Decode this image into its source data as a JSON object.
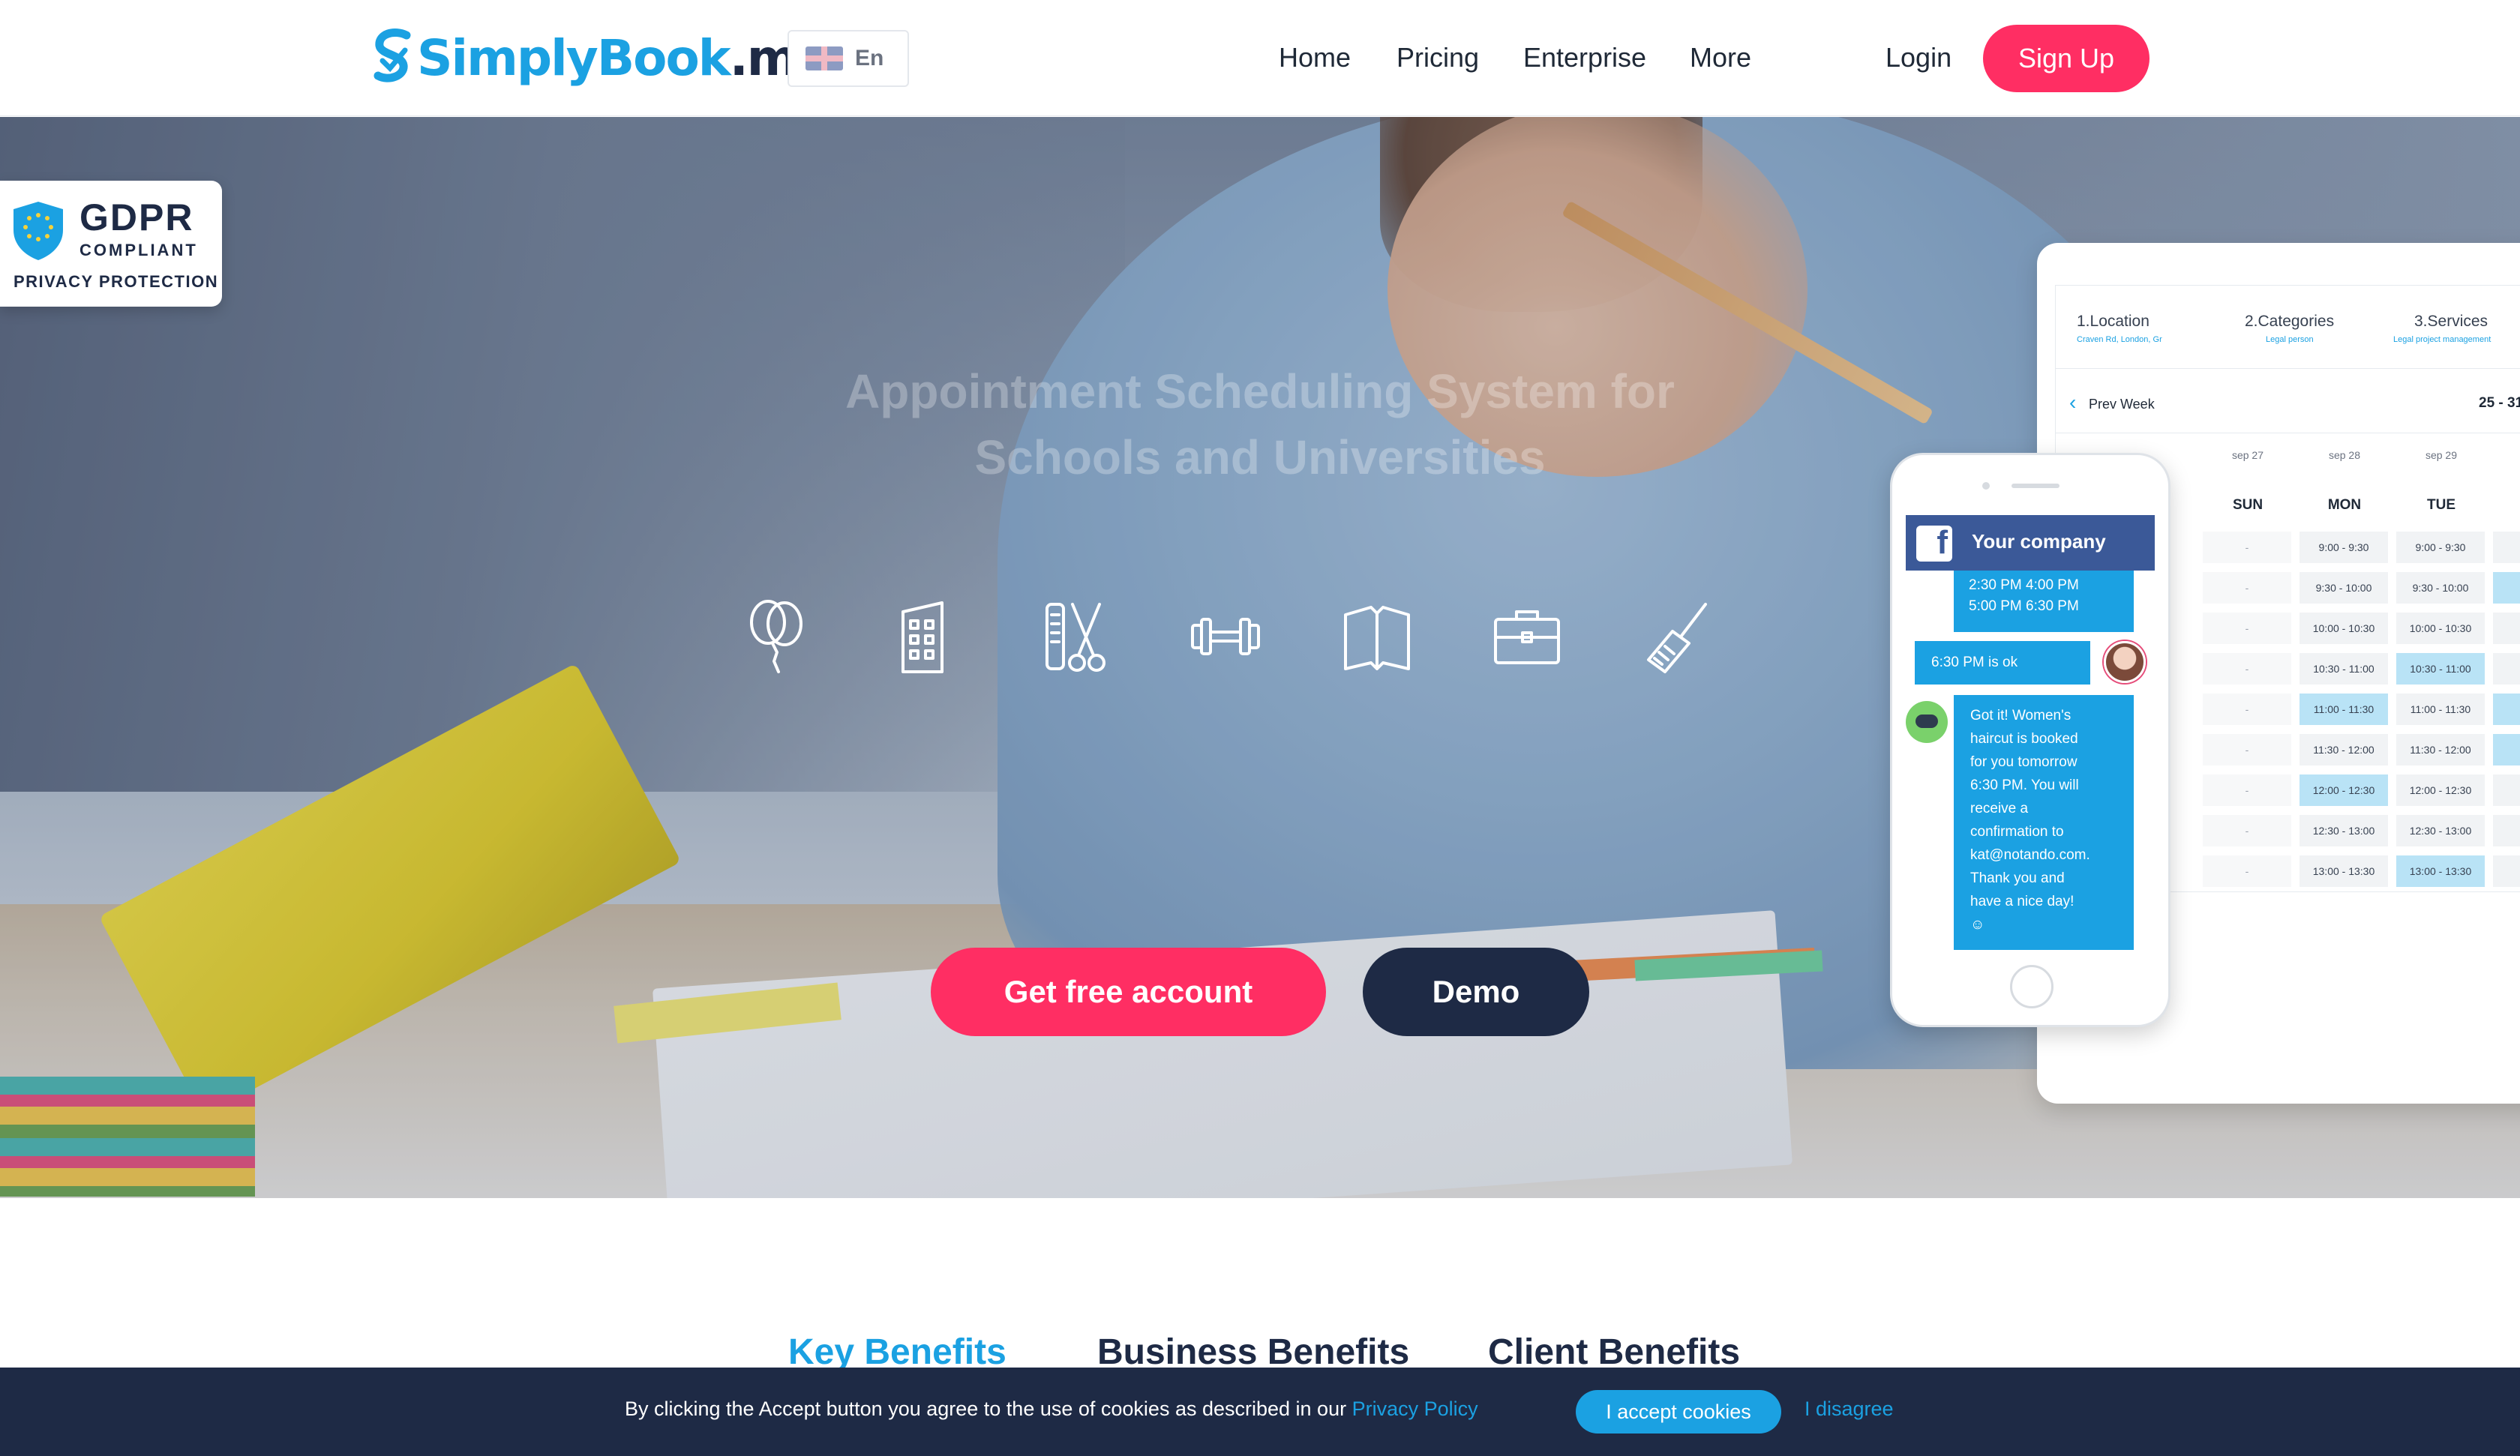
{
  "header": {
    "logo_main": "SimplyBook",
    "logo_suffix": ".me",
    "language": "En",
    "nav": [
      "Home",
      "Pricing",
      "Enterprise",
      "More"
    ],
    "login": "Login",
    "signup": "Sign Up"
  },
  "gdpr": {
    "title": "GDPR",
    "subtitle": "COMPLIANT",
    "footer": "PRIVACY PROTECTION"
  },
  "hero": {
    "title_line1": "Appointment Scheduling System for",
    "title_line2": "Schools and Universities",
    "icons": [
      "balloons-icon",
      "building-icon",
      "salon-tools-icon",
      "dumbbell-icon",
      "book-icon",
      "briefcase-icon",
      "cleaning-brush-icon"
    ],
    "cta_primary": "Get free account",
    "cta_secondary": "Demo"
  },
  "booking_widget": {
    "steps": [
      {
        "label": "1.Location",
        "sub": "Craven Rd, London, Gr"
      },
      {
        "label": "2.Categories",
        "sub": "Legal person"
      },
      {
        "label": "3.Services",
        "sub": "Legal project management"
      }
    ],
    "prev_week": "Prev Week",
    "range": "25 - 31",
    "days": [
      {
        "date": "sep 27",
        "name": "SUN"
      },
      {
        "date": "sep 28",
        "name": "MON"
      },
      {
        "date": "sep 29",
        "name": "TUE"
      }
    ],
    "slots": [
      "9:00 - 9:30",
      "9:30 - 10:00",
      "10:00 - 10:30",
      "10:30 - 11:00",
      "11:00 - 11:30",
      "11:30 - 12:00",
      "12:00 - 12:30",
      "12:30 - 13:00",
      "13:00 - 13:30"
    ]
  },
  "phone": {
    "page_name": "Your company",
    "times_line1": "2:30 PM  4:00 PM",
    "times_line2": "5:00 PM  6:30 PM",
    "user_message": "6:30 PM is ok",
    "bot_lines": [
      "Got it! Women's",
      "haircut is booked",
      "for you tomorrow",
      "6:30 PM.  You will",
      "receive a",
      "confirmation to",
      "kat@notando.com.",
      "Thank you and",
      "have a nice day!",
      "☺"
    ]
  },
  "tabs": [
    "Key Benefits",
    "Business Benefits",
    "Client Benefits"
  ],
  "cookie": {
    "text": "By clicking the Accept button you agree to the use of cookies as described in our",
    "link": "Privacy Policy",
    "accept": "I accept cookies",
    "disagree": "I disagree"
  },
  "colors": {
    "brand_blue": "#1ba1e2",
    "brand_pink": "#ff2e63",
    "navy": "#1e2a45",
    "facebook": "#3b5998"
  }
}
